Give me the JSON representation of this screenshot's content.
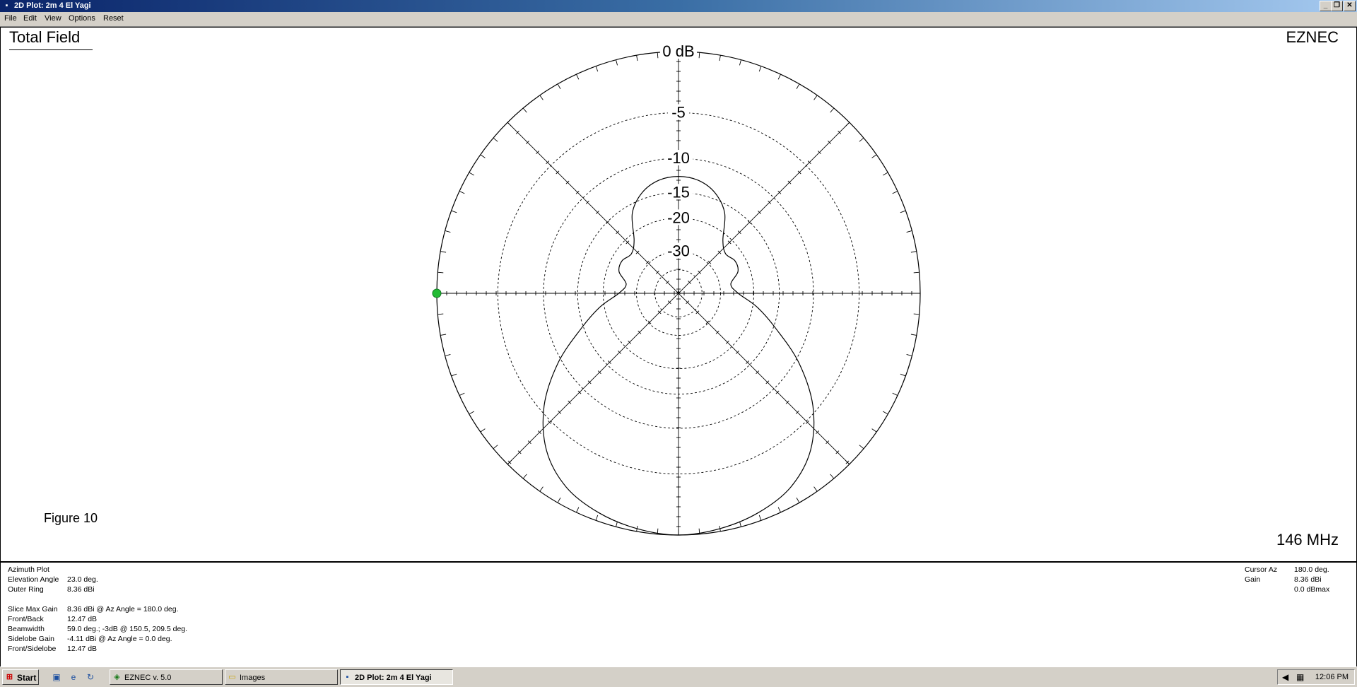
{
  "window": {
    "title": "2D Plot: 2m 4 El Yagi",
    "controls": {
      "minimize": "_",
      "restore": "❐",
      "close": "✕"
    }
  },
  "menu": [
    "File",
    "Edit",
    "View",
    "Options",
    "Reset"
  ],
  "plot": {
    "title": "Total Field",
    "brand": "EZNEC",
    "figure_label": "Figure 10",
    "frequency": "146 MHz",
    "ring_labels": [
      "0 dB",
      "-5",
      "-10",
      "-15",
      "-20",
      "-30"
    ]
  },
  "chart_data": {
    "type": "polar",
    "ring_levels_db": [
      0,
      -5,
      -10,
      -15,
      -20,
      -30,
      -40
    ],
    "scale": "ARRL log-periodic (0.89 per 2 dB)",
    "pattern_max_db": 0,
    "cursor_azimuth_deg": 180,
    "series": [
      {
        "points": [
          {
            "az": 0,
            "db": -12.47
          },
          {
            "az": 10,
            "db": -12.8
          },
          {
            "az": 20,
            "db": -14.0
          },
          {
            "az": 30,
            "db": -16.5
          },
          {
            "az": 40,
            "db": -21.5
          },
          {
            "az": 50,
            "db": -23.5
          },
          {
            "az": 60,
            "db": -22.5
          },
          {
            "az": 70,
            "db": -23.0
          },
          {
            "az": 80,
            "db": -26.0
          },
          {
            "az": 90,
            "db": -24.0
          },
          {
            "az": 100,
            "db": -19.0
          },
          {
            "az": 110,
            "db": -14.5
          },
          {
            "az": 120,
            "db": -9.5
          },
          {
            "az": 130,
            "db": -5.5
          },
          {
            "az": 140,
            "db": -2.8
          },
          {
            "az": 150,
            "db": -1.3
          },
          {
            "az": 160,
            "db": -0.6
          },
          {
            "az": 170,
            "db": -0.2
          },
          {
            "az": 180,
            "db": 0
          }
        ]
      }
    ]
  },
  "info": {
    "left": [
      {
        "label": "Azimuth Plot",
        "value": ""
      },
      {
        "label": "Elevation Angle",
        "value": "23.0 deg."
      },
      {
        "label": "Outer Ring",
        "value": "8.36 dBi"
      },
      {
        "label": "",
        "value": ""
      },
      {
        "label": "Slice Max Gain",
        "value": "8.36 dBi @ Az Angle = 180.0 deg."
      },
      {
        "label": "Front/Back",
        "value": "12.47 dB"
      },
      {
        "label": "Beamwidth",
        "value": "59.0 deg.; -3dB @ 150.5, 209.5 deg."
      },
      {
        "label": "Sidelobe Gain",
        "value": "-4.11 dBi @ Az Angle = 0.0 deg."
      },
      {
        "label": "Front/Sidelobe",
        "value": "12.47 dB"
      }
    ],
    "right": [
      {
        "label": "Cursor Az",
        "value": "180.0 deg."
      },
      {
        "label": "Gain",
        "value": "8.36 dBi"
      },
      {
        "label": "",
        "value": "0.0 dBmax"
      }
    ]
  },
  "taskbar": {
    "start": "Start",
    "buttons": [
      "EZNEC  v. 5.0",
      "Images",
      "2D Plot: 2m 4 El Yagi"
    ],
    "clock": "12:06 PM"
  }
}
